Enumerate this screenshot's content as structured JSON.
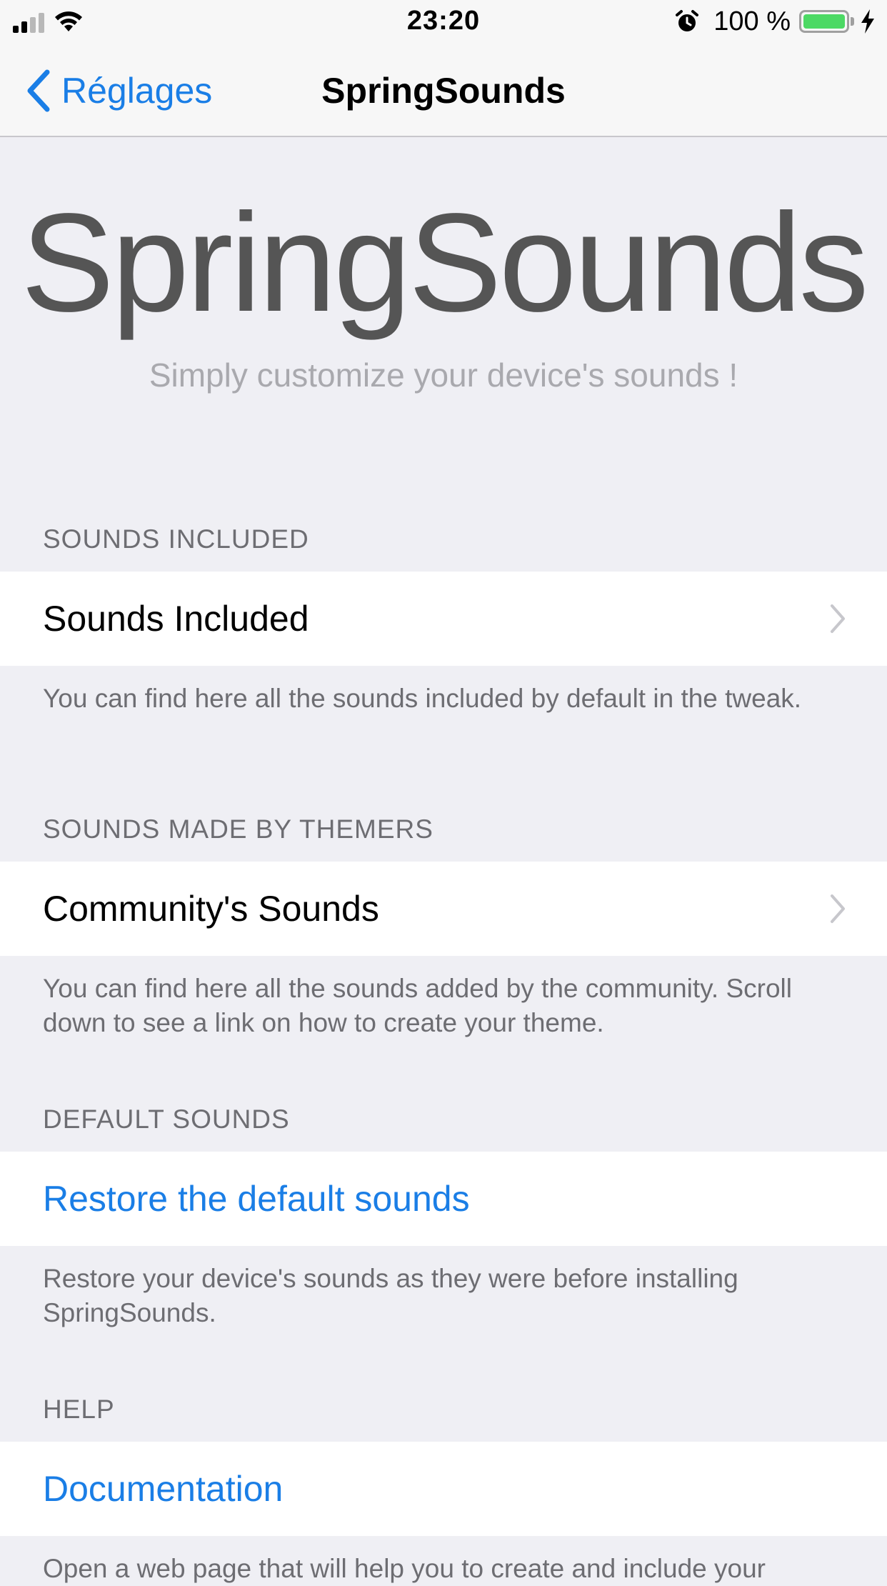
{
  "status_bar": {
    "time": "23:20",
    "battery": "100 %",
    "icons": [
      "signal-icon",
      "wifi-icon",
      "alarm-icon",
      "battery-icon",
      "charging-bolt-icon"
    ]
  },
  "nav": {
    "back_label": "Réglages",
    "title": "SpringSounds"
  },
  "banner": {
    "title": "SpringSounds",
    "subtitle": "Simply customize your device's sounds !"
  },
  "sections": [
    {
      "header": "SOUNDS INCLUDED",
      "cell": "Sounds Included",
      "footer": "You can find here all the sounds included by default in the tweak."
    },
    {
      "header": "SOUNDS MADE BY THEMERS",
      "cell": "Community's Sounds",
      "footer": "You can find here all the sounds added by the community. Scroll down to see a link on how to create your theme."
    },
    {
      "header": "DEFAULT SOUNDS",
      "cell": "Restore the default sounds",
      "footer": "Restore your device's sounds as they were before installing SpringSounds."
    },
    {
      "header": "HELP",
      "cell": "Documentation",
      "footer": "Open a web page that will help you to create and include your"
    }
  ],
  "colors": {
    "accent": "#1a7ee6",
    "background": "#efeff4",
    "battery": "#4cd964"
  }
}
